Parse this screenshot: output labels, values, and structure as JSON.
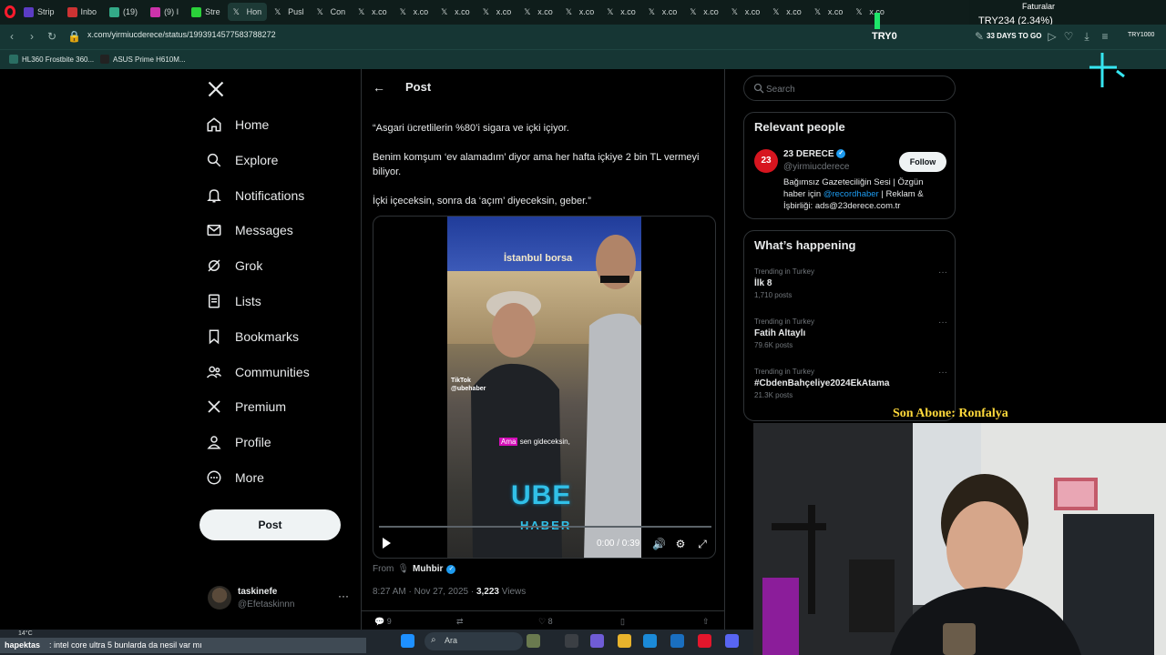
{
  "browser": {
    "tabs": [
      {
        "label": "Strip",
        "color": "#5b3cc4"
      },
      {
        "label": "Inbo",
        "color": "#c33"
      },
      {
        "label": "(19)",
        "color": "#3a8"
      },
      {
        "label": "(9) I",
        "color": "#c3a"
      },
      {
        "label": "Stre",
        "color": "#2ad13a"
      },
      {
        "label": "Hon",
        "color": "#fff",
        "active": true
      },
      {
        "label": "Pusl",
        "color": "#fff"
      },
      {
        "label": "Con",
        "color": "#fff"
      },
      {
        "label": "x.co",
        "color": "#fff"
      },
      {
        "label": "x.co",
        "color": "#fff"
      },
      {
        "label": "x.co",
        "color": "#fff"
      },
      {
        "label": "x.co",
        "color": "#fff"
      },
      {
        "label": "x.co",
        "color": "#fff"
      },
      {
        "label": "x.co",
        "color": "#fff"
      },
      {
        "label": "x.co",
        "color": "#fff"
      },
      {
        "label": "x.co",
        "color": "#fff"
      },
      {
        "label": "x.co",
        "color": "#fff"
      },
      {
        "label": "x.co",
        "color": "#fff"
      },
      {
        "label": "x.co",
        "color": "#fff"
      },
      {
        "label": "x.co",
        "color": "#fff"
      },
      {
        "label": "x.co",
        "color": "#fff"
      }
    ],
    "url": "x.com/yirmiucderece/status/1993914577583788272",
    "bookmarks": [
      "HL360 Frostbite 360...",
      "ASUS Prime H610M..."
    ]
  },
  "stream_overlay": {
    "ticker_title": "Faturalar",
    "ticker_value": "TRY234 (2.34%)",
    "goal_current": "TRY0",
    "days_to_go": "33 DAYS TO GO",
    "goal_target": "TRY1000",
    "last_subscriber": "Son Abone: Ronfalya"
  },
  "nav": {
    "items": [
      {
        "label": "Home",
        "icon": "home-icon"
      },
      {
        "label": "Explore",
        "icon": "search-icon"
      },
      {
        "label": "Notifications",
        "icon": "bell-icon"
      },
      {
        "label": "Messages",
        "icon": "mail-icon"
      },
      {
        "label": "Grok",
        "icon": "grok-icon"
      },
      {
        "label": "Lists",
        "icon": "list-icon"
      },
      {
        "label": "Bookmarks",
        "icon": "bookmark-icon"
      },
      {
        "label": "Communities",
        "icon": "people-icon"
      },
      {
        "label": "Premium",
        "icon": "x-logo-icon"
      },
      {
        "label": "Profile",
        "icon": "person-icon"
      },
      {
        "label": "More",
        "icon": "more-circle-icon"
      }
    ],
    "post_button": "Post",
    "account": {
      "name": "taskinefe",
      "handle": "@Efetaskinnn"
    }
  },
  "post": {
    "header_title": "Post",
    "paragraphs": [
      "“Asgari ücretlilerin %80’i sigara ve içki içiyor.",
      "Benim komşum ‘ev alamadım’ diyor ama her hafta içkiye 2 bin TL vermeyi biliyor.",
      "İçki içeceksin, sonra da ‘açım’ diyeceksin, geber.”"
    ],
    "video": {
      "sign_text": "İstanbul borsa",
      "tiktok_label": "TikTok",
      "tiktok_handle": "@ubehaber",
      "caption_highlight": "Ama",
      "caption_rest": "sen gideceksin,",
      "brand_top": "UBE",
      "brand_bottom": "HABER",
      "time": "0:00 / 0:39",
      "progress": 0
    },
    "from_label": "From",
    "from_source": "Muhbir",
    "timestamp": "8:27 AM · Nov 27, 2025 ·",
    "views_count": "3,223",
    "views_label": "Views",
    "actions": {
      "replies": "9",
      "likes": "8"
    }
  },
  "sidebar": {
    "search_placeholder": "Search",
    "relevant_title": "Relevant people",
    "person": {
      "avatar_text": "23",
      "name": "23 DERECE",
      "handle": "@yirmiucderece",
      "follow_label": "Follow",
      "bio_1": "Bağımsız Gazeteciliğin Sesi | Özgün haber için",
      "bio_link": "@recordhaber",
      "bio_2": "| Reklam & İşbirliği: ads@23derece.com.tr"
    },
    "happening_title": "What’s happening",
    "trends": [
      {
        "category": "Trending in Turkey",
        "name": "İlk 8",
        "count": "1,710 posts"
      },
      {
        "category": "Trending in Turkey",
        "name": "Fatih Altaylı",
        "count": "79.6K posts"
      },
      {
        "category": "Trending in Turkey",
        "name": "#CbdenBahçeliye2024EkAtama",
        "count": "21.3K posts"
      }
    ]
  },
  "taskbar": {
    "weather": "14°C",
    "chat_user": "hapektas",
    "chat_message": ": intel core ultra 5 bunlarda da nesil var mı",
    "search_label": "Ara"
  }
}
